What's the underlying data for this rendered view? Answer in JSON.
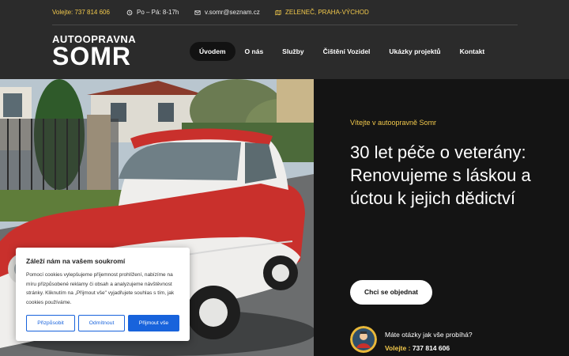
{
  "topbar": {
    "phone": "Volejte: 737 814 606",
    "hours": "Po – Pá: 8-17h",
    "email": "v.somr@seznam.cz",
    "location": "ZELENEČ, PRAHA-VÝCHOD"
  },
  "logo": {
    "line1": "AUTOOPRAVNA",
    "line2": "SOMR"
  },
  "nav": {
    "items": [
      {
        "label": "Úvodem",
        "active": true
      },
      {
        "label": "O nás"
      },
      {
        "label": "Služby"
      },
      {
        "label": "Čištění Vozidel"
      },
      {
        "label": "Ukázky projektů"
      },
      {
        "label": "Kontakt"
      }
    ]
  },
  "hero": {
    "subtitle": "Vítejte v autoopravně Somr",
    "title": "30 let péče o veterány: Renovujeme s láskou a úctou k jejich dědictví",
    "button": "Chci se objednat",
    "question": "Máte otázky jak vše probíhá?",
    "phone_label": "Volejte :",
    "phone_number": "737 814 606"
  },
  "cookie": {
    "title": "Záleží nám na vašem soukromí",
    "text": "Pomocí cookies vylepšujeme příjemnost prohlížení, nabízíme na míru přizpůsobené reklamy či obsah a analyzujeme návštěvnost stránky. Kliknutím na „Přijmout vše\" vyjadřujete souhlas s tím, jak cookies používáme.",
    "customize": "Přizpůsobit",
    "reject": "Odmítnout",
    "accept": "Přijmout vše"
  },
  "colors": {
    "accent": "#f2c94c",
    "header_bg": "#2b2b2b",
    "hero_bg": "#141414",
    "cookie_button": "#1863dc"
  },
  "icons": [
    "clock-icon",
    "mail-icon",
    "map-icon",
    "mechanic-avatar"
  ]
}
